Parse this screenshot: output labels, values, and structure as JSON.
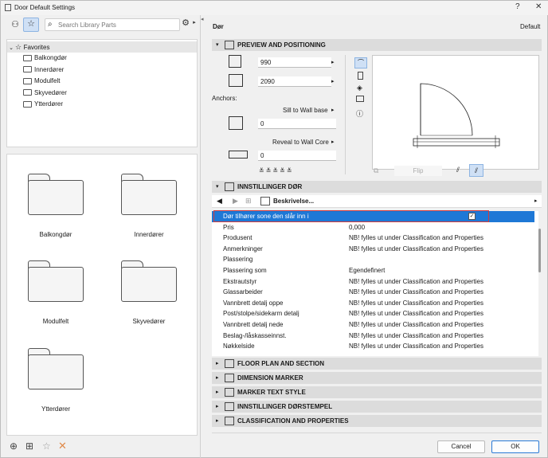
{
  "window": {
    "title": "Door Default Settings",
    "help": "?",
    "close": "✕"
  },
  "left": {
    "search_placeholder": "Search Library Parts",
    "tree": {
      "root": "Favorites",
      "items": [
        "Balkongdør",
        "Innerdører",
        "Modulfelt",
        "Skyvedører",
        "Ytterdører"
      ]
    },
    "grid": [
      "Balkongdør",
      "Innerdører",
      "Modulfelt",
      "Skyvedører",
      "Ytterdører"
    ]
  },
  "header": {
    "name": "Dør",
    "default_label": "Default"
  },
  "preview_section": {
    "title": "PREVIEW AND POSITIONING",
    "width": "990",
    "height": "2090",
    "anchors_label": "Anchors:",
    "sill_label": "Sill to Wall base",
    "sill_value": "0",
    "reveal_label": "Reveal to Wall Core",
    "reveal_value": "0",
    "flip_label": "Flip"
  },
  "settings_section": {
    "title": "INNSTILLINGER DØR",
    "nav_label": "Beskrivelse...",
    "rows": [
      {
        "name": "Dør tilhører sone den slår inn i",
        "value": ""
      },
      {
        "name": "Pris",
        "value": "0,000"
      },
      {
        "name": "Produsent",
        "value": "NB! fylles ut under Classification and Properties"
      },
      {
        "name": "Anmerkninger",
        "value": "NB! fylles ut under Classification and Properties"
      },
      {
        "name": "Plassering",
        "value": ""
      },
      {
        "name": "Plassering som",
        "value": "Egendefinert"
      },
      {
        "name": "Ekstrautstyr",
        "value": "NB! fylles ut under Classification and Properties"
      },
      {
        "name": "Glassarbeider",
        "value": "NB! fylles ut under Classification and Properties"
      },
      {
        "name": "Vannbrett detalj oppe",
        "value": "NB! fylles ut under Classification and Properties"
      },
      {
        "name": "Post/stolpe/sidekarm detalj",
        "value": "NB! fylles ut under Classification and Properties"
      },
      {
        "name": "Vannbrett detalj nede",
        "value": "NB! fylles ut under Classification and Properties"
      },
      {
        "name": "Beslag-/låskasseinnst.",
        "value": "NB! fylles ut under Classification and Properties"
      },
      {
        "name": "Nøkkelside",
        "value": "NB! fylles ut under Classification and Properties"
      }
    ]
  },
  "collapsed_sections": [
    "FLOOR PLAN AND SECTION",
    "DIMENSION MARKER",
    "MARKER TEXT STYLE",
    "INNSTILLINGER DØRSTEMPEL",
    "CLASSIFICATION AND PROPERTIES"
  ],
  "buttons": {
    "cancel": "Cancel",
    "ok": "OK"
  }
}
